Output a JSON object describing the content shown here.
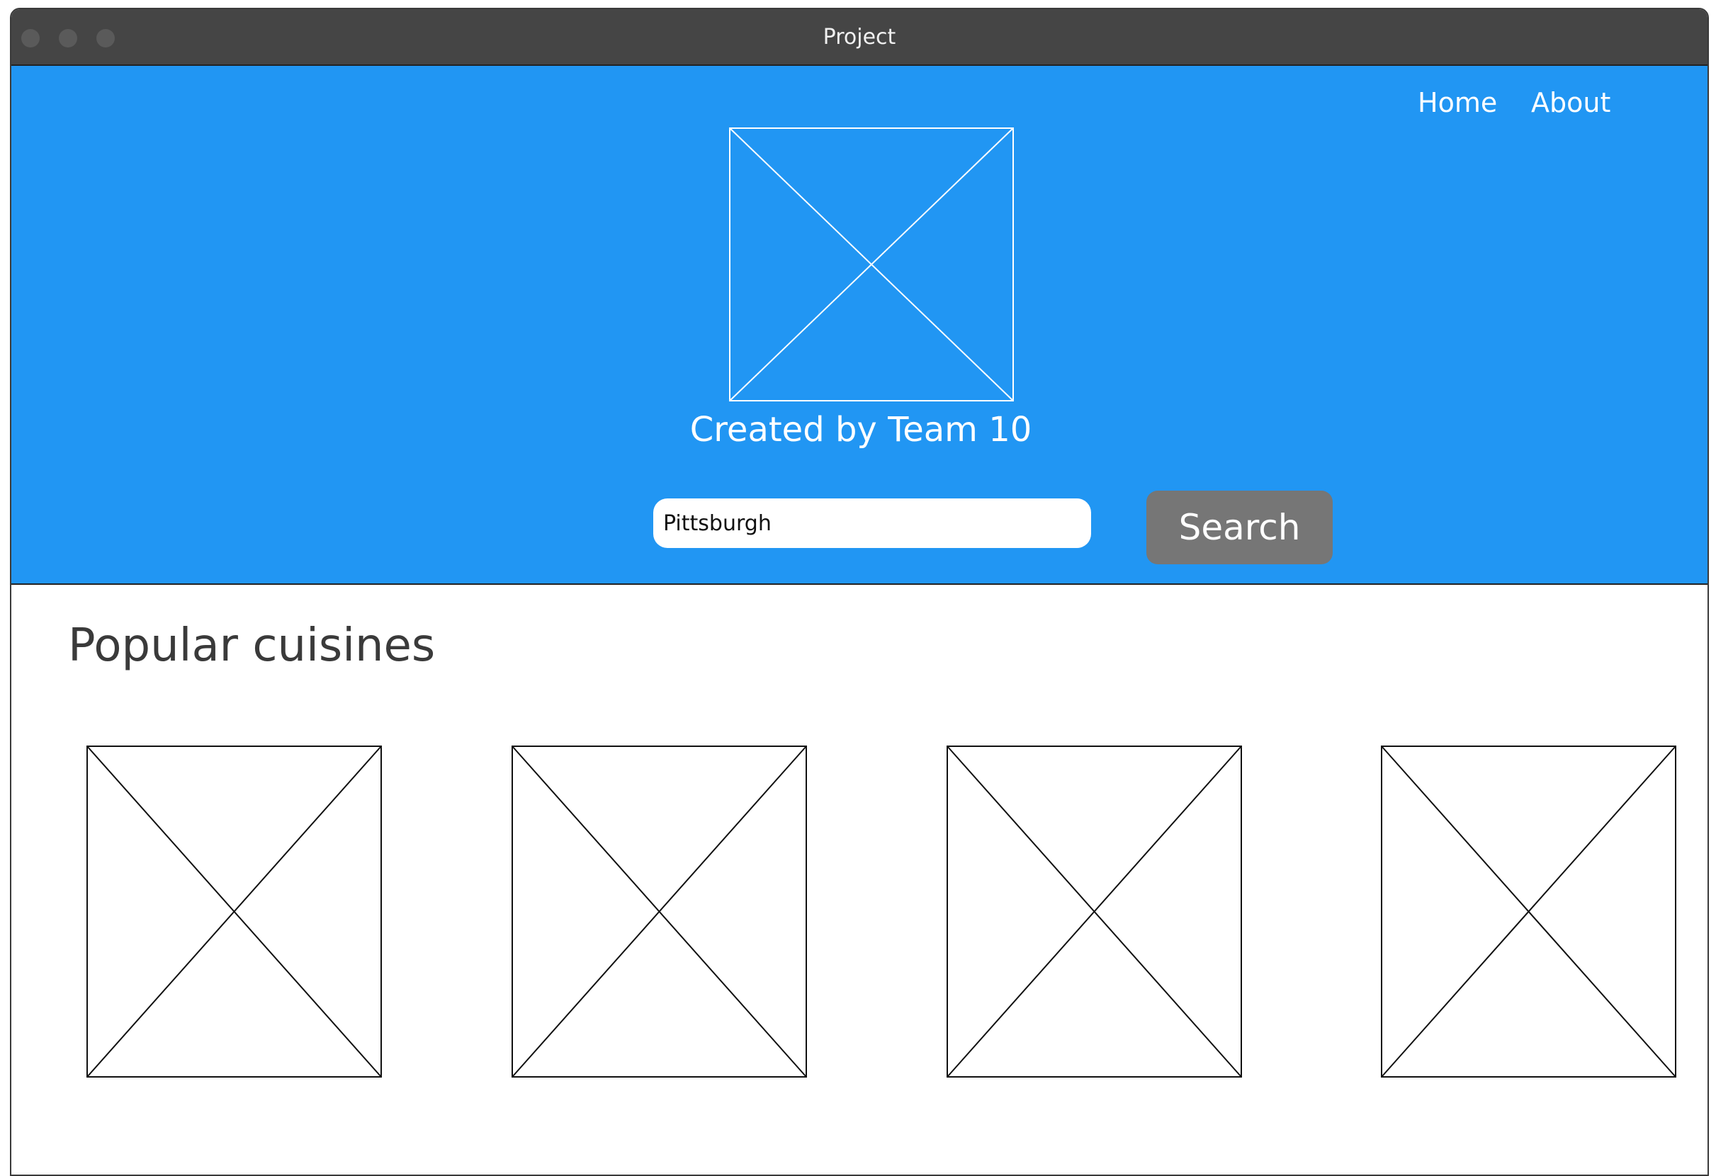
{
  "window": {
    "title": "Project"
  },
  "nav": {
    "items": [
      {
        "label": "Home"
      },
      {
        "label": "About"
      }
    ]
  },
  "hero": {
    "logo_icon": "image-placeholder-icon",
    "credit": "Created by Team 10",
    "search": {
      "value": "Pittsburgh",
      "button_label": "Search"
    }
  },
  "cuisines": {
    "title": "Popular cuisines",
    "items": [
      {
        "icon": "image-placeholder-icon"
      },
      {
        "icon": "image-placeholder-icon"
      },
      {
        "icon": "image-placeholder-icon"
      },
      {
        "icon": "image-placeholder-icon"
      }
    ]
  },
  "colors": {
    "hero_background": "#2196f3",
    "titlebar": "#454545",
    "search_button": "#767676"
  }
}
